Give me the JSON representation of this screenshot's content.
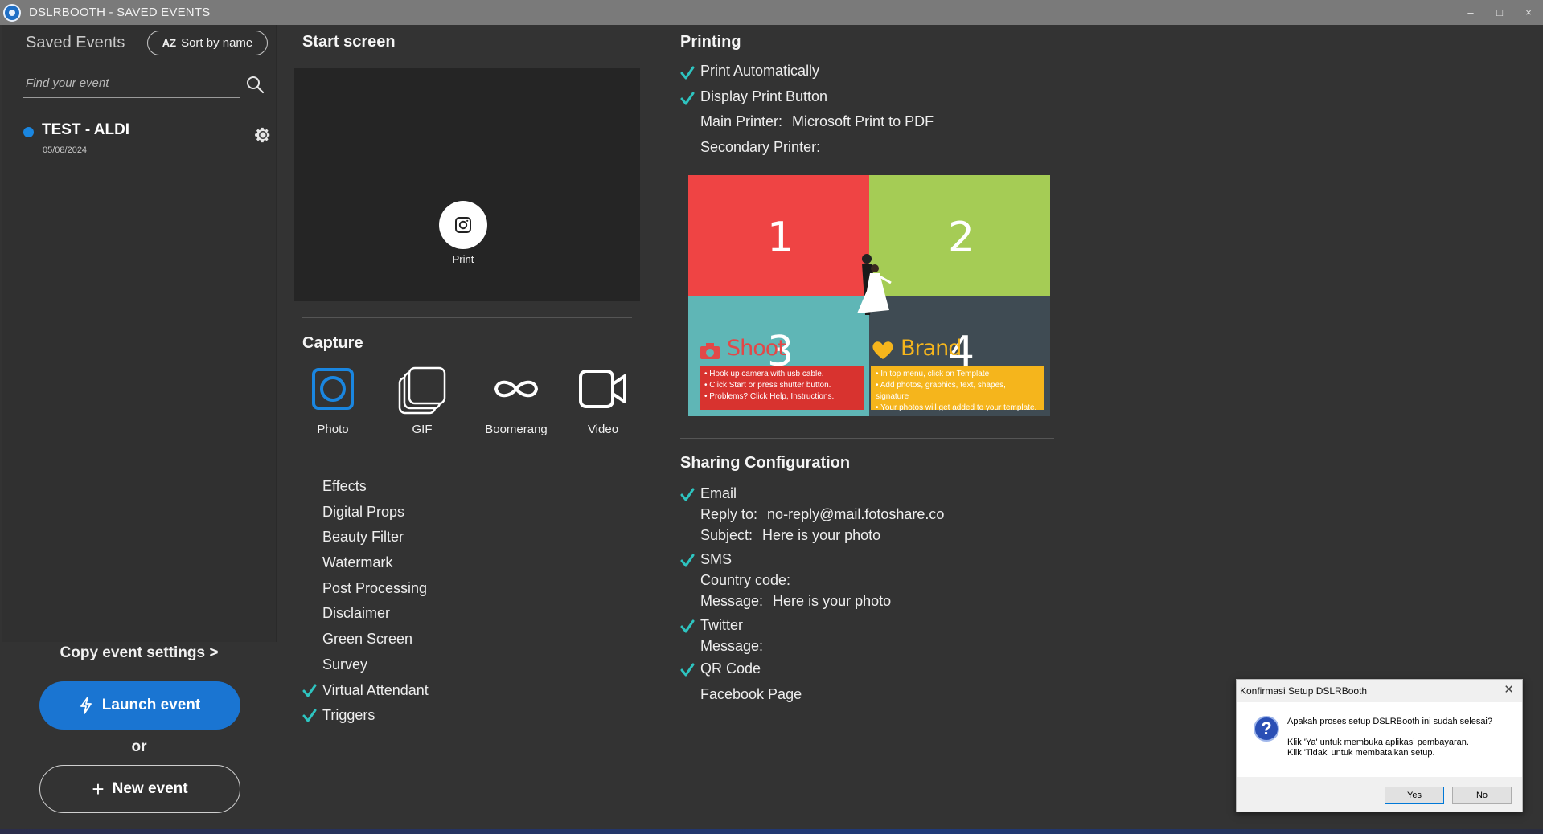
{
  "window": {
    "title": "DSLRBOOTH - SAVED EVENTS",
    "controls": [
      "–",
      "□",
      "×"
    ]
  },
  "sidebar": {
    "title": "Saved Events",
    "sort_label": "Sort by name",
    "sort_icon": "AZ",
    "search_placeholder": "Find your event",
    "events": [
      {
        "name": "TEST - ALDI",
        "date": "05/08/2024",
        "status_color": "#1a86e0"
      }
    ],
    "copy_settings": "Copy event settings >",
    "launch_label": "Launch event",
    "or_label": "or",
    "new_event_label": "New event"
  },
  "start_screen": {
    "title": "Start screen",
    "print_label": "Print"
  },
  "capture": {
    "title": "Capture",
    "modes": [
      {
        "label": "Photo",
        "icon": "photo-icon",
        "active": true
      },
      {
        "label": "GIF",
        "icon": "gif-icon",
        "active": false
      },
      {
        "label": "Boomerang",
        "icon": "boomerang-icon",
        "active": false
      },
      {
        "label": "Video",
        "icon": "video-icon",
        "active": false
      }
    ],
    "options": [
      {
        "label": "Effects",
        "checked": false
      },
      {
        "label": "Digital Props",
        "checked": false
      },
      {
        "label": "Beauty Filter",
        "checked": false
      },
      {
        "label": "Watermark",
        "checked": false
      },
      {
        "label": "Post Processing",
        "checked": false
      },
      {
        "label": "Disclaimer",
        "checked": false
      },
      {
        "label": "Green Screen",
        "checked": false
      },
      {
        "label": "Survey",
        "checked": false
      },
      {
        "label": "Virtual Attendant",
        "checked": true
      },
      {
        "label": "Triggers",
        "checked": true
      }
    ]
  },
  "printing": {
    "title": "Printing",
    "print_automatically": "Print Automatically",
    "display_print_button": "Display Print Button",
    "main_printer_label": "Main Printer:",
    "main_printer_value": "Microsoft Print to PDF",
    "secondary_printer_label": "Secondary Printer:",
    "template": {
      "numbers": [
        "1",
        "2",
        "3",
        "4"
      ],
      "shoot_heading": "Shoot",
      "brand_heading": "Brand",
      "shoot_lines": [
        "• Hook up camera with usb cable.",
        "• Click Start or press shutter button.",
        "• Problems? Click Help, Instructions."
      ],
      "brand_lines": [
        "• In top menu, click on Template",
        "• Add photos, graphics, text, shapes, signature",
        "• Your photos will get added to your template."
      ],
      "colors": {
        "q1": "#ef4444",
        "q2": "#a5cc55",
        "q3": "#5fb6b6",
        "q4": "#3f4b53"
      }
    }
  },
  "sharing": {
    "title": "Sharing Configuration",
    "email": "Email",
    "reply_to_label": "Reply to:",
    "reply_to_value": "no-reply@mail.fotoshare.co",
    "subject_label": "Subject:",
    "subject_value": "Here is your photo",
    "sms": "SMS",
    "country_code_label": "Country code:",
    "message_label": "Message:",
    "sms_message_value": "Here is your photo",
    "twitter": "Twitter",
    "twitter_message_label": "Message:",
    "qr_code": "QR Code",
    "facebook_page": "Facebook Page"
  },
  "dialog": {
    "title": "Konfirmasi Setup DSLRBooth",
    "close": "✕",
    "line1": "Apakah proses setup DSLRBooth ini sudah selesai?",
    "line2": "Klik 'Ya' untuk membuka aplikasi pembayaran.",
    "line3": "Klik 'Tidak' untuk membatalkan setup.",
    "yes_label": "Yes",
    "no_label": "No",
    "icon": "question-icon"
  },
  "accent_color": "#1a75d2",
  "check_color": "#2ec4c0"
}
